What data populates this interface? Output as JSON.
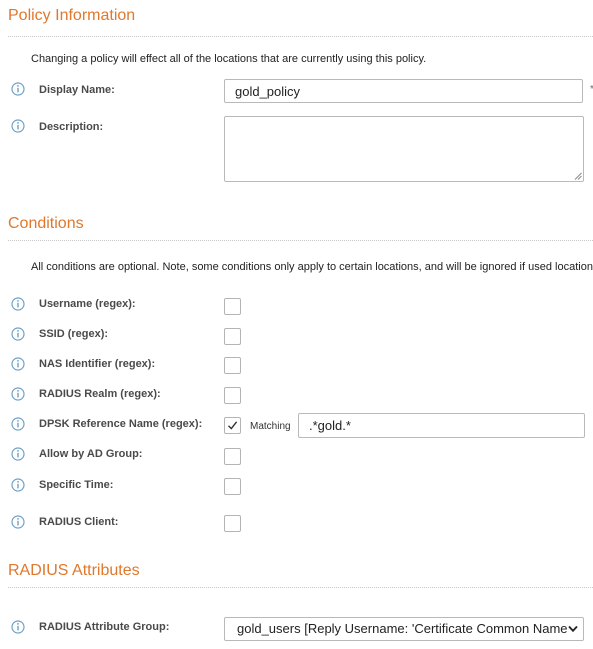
{
  "policy_information": {
    "title": "Policy Information",
    "note": "Changing a policy will effect all of the locations that are currently using this policy.",
    "display_name": {
      "label": "Display Name:",
      "value": "gold_policy",
      "required_mark": "*"
    },
    "description": {
      "label": "Description:",
      "value": ""
    }
  },
  "conditions": {
    "title": "Conditions",
    "note": "All conditions are optional. Note, some conditions only apply to certain locations, and will be ignored if used locations t",
    "rows": [
      {
        "label": "Username (regex):",
        "checked": false
      },
      {
        "label": "SSID (regex):",
        "checked": false
      },
      {
        "label": "NAS Identifier (regex):",
        "checked": false
      },
      {
        "label": "RADIUS Realm (regex):",
        "checked": false
      },
      {
        "label": "DPSK Reference Name (regex):",
        "checked": true,
        "matching_label": "Matching",
        "matching_value": ".*gold.*"
      },
      {
        "label": "Allow by AD Group:",
        "checked": false
      },
      {
        "label": "Specific Time:",
        "checked": false
      },
      {
        "label": "RADIUS Client:",
        "checked": false
      }
    ]
  },
  "radius_attributes": {
    "title": "RADIUS Attributes",
    "group": {
      "label": "RADIUS Attribute Group:",
      "selected": "gold_users [Reply Username: 'Certificate Common Name"
    }
  },
  "colors": {
    "accent": "#e0782d",
    "info_icon": "#6fa1c4",
    "label": "#4a4a4a"
  },
  "icons": {
    "info": "info-icon",
    "check": "checkmark-icon",
    "dropdown": "chevron-down-icon"
  }
}
